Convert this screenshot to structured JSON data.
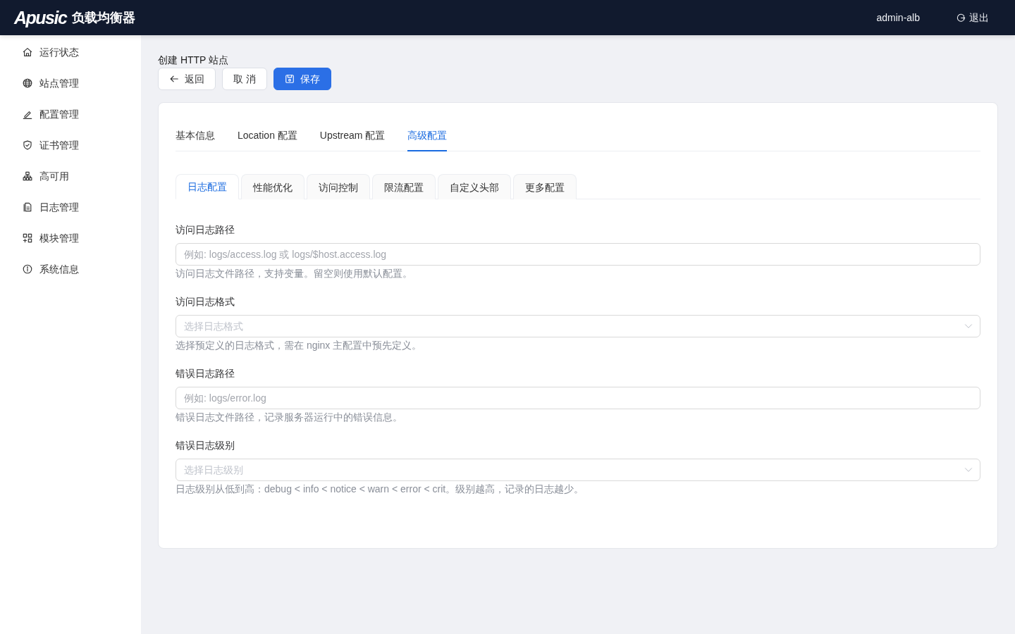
{
  "header": {
    "logo": "Apusic",
    "product": "负载均衡器",
    "user": "admin-alb",
    "logout": "退出"
  },
  "sidebar": {
    "items": [
      {
        "label": "运行状态",
        "selected": false
      },
      {
        "label": "站点管理",
        "selected": false
      },
      {
        "label": "配置管理",
        "selected": false
      },
      {
        "label": "证书管理",
        "selected": false
      },
      {
        "label": "高可用",
        "selected": false
      },
      {
        "label": "日志管理",
        "selected": false
      },
      {
        "label": "模块管理",
        "selected": false
      },
      {
        "label": "系统信息",
        "selected": false
      }
    ]
  },
  "page": {
    "title": "创建 HTTP 站点",
    "buttons": [
      {
        "label": "返回",
        "kind": "back"
      },
      {
        "label": "取 消",
        "kind": "default"
      },
      {
        "label": "保存",
        "kind": "primary"
      }
    ]
  },
  "tabs": [
    {
      "label": "基本信息",
      "selected": false
    },
    {
      "label": "Location 配置",
      "selected": false
    },
    {
      "label": "Upstream 配置",
      "selected": false
    },
    {
      "label": "高级配置",
      "selected": true
    }
  ],
  "sub_tabs": [
    {
      "label": "日志配置",
      "selected": true
    },
    {
      "label": "性能优化",
      "selected": false
    },
    {
      "label": "访问控制",
      "selected": false
    },
    {
      "label": "限流配置",
      "selected": false
    },
    {
      "label": "自定义头部",
      "selected": false
    },
    {
      "label": "更多配置",
      "selected": false
    }
  ],
  "fields": [
    {
      "kind": "input",
      "label": "访问日志路径",
      "placeholder": "例如: logs/access.log 或 logs/$host.access.log",
      "help": "访问日志文件路径，支持变量。留空则使用默认配置。"
    },
    {
      "kind": "select",
      "label": "访问日志格式",
      "placeholder": "选择日志格式",
      "help": "选择预定义的日志格式，需在 nginx 主配置中预先定义。"
    },
    {
      "kind": "input",
      "label": "错误日志路径",
      "placeholder": "例如: logs/error.log",
      "help": "错误日志文件路径，记录服务器运行中的错误信息。"
    },
    {
      "kind": "select",
      "label": "错误日志级别",
      "placeholder": "选择日志级别",
      "help": "日志级别从低到高：debug < info < notice < warn < error < crit。级别越高，记录的日志越少。"
    }
  ]
}
